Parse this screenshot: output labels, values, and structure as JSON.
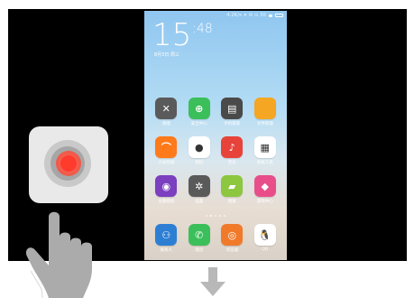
{
  "status_bar": {
    "text": "4.2K/s ✦ ✉ ⊙ 30"
  },
  "lock_clock": {
    "hours": "15",
    "minutes": "48",
    "date": "8月3日 周三"
  },
  "apps": [
    [
      {
        "label": "清理",
        "color": "#5a5a5a",
        "glyph": "✕",
        "icon": "cleaner-icon"
      },
      {
        "label": "安全中心",
        "color": "#3bbf5a",
        "glyph": "⊕",
        "icon": "security-shield-icon"
      },
      {
        "label": "手机管家",
        "color": "#4a4a4a",
        "glyph": "▤",
        "icon": "manager-icon"
      },
      {
        "label": "文件管理",
        "color": "#f5a623",
        "glyph": "",
        "icon": "folder-icon"
      }
    ],
    [
      {
        "label": "小米商城",
        "color": "#ff7a1a",
        "glyph": "⌒",
        "icon": "mi-store-icon"
      },
      {
        "label": "相机",
        "color": "#ffffff",
        "glyph": "●",
        "icon": "camera-icon"
      },
      {
        "label": "音乐",
        "color": "#e8433a",
        "glyph": "♪",
        "icon": "music-icon"
      },
      {
        "label": "系统工具",
        "color": "#ffffff",
        "glyph": "▦",
        "icon": "tools-folder-icon"
      }
    ],
    [
      {
        "label": "主题壁纸",
        "color": "#7b3fbf",
        "glyph": "◉",
        "icon": "themes-icon"
      },
      {
        "label": "设置",
        "color": "#5a5a5a",
        "glyph": "✲",
        "icon": "settings-gear-icon"
      },
      {
        "label": "相册",
        "color": "#8dc63f",
        "glyph": "▰",
        "icon": "gallery-icon"
      },
      {
        "label": "游戏中心",
        "color": "#e84f8a",
        "glyph": "◆",
        "icon": "game-center-icon"
      }
    ]
  ],
  "dock": [
    {
      "label": "联系人",
      "color": "#2d7fd4",
      "glyph": "⚇",
      "icon": "contacts-icon"
    },
    {
      "label": "电话",
      "color": "#3bbf5a",
      "glyph": "✆",
      "icon": "phone-icon"
    },
    {
      "label": "浏览器",
      "color": "#f07a2a",
      "glyph": "◎",
      "icon": "browser-icon"
    },
    {
      "label": "QQ",
      "color": "#ffffff",
      "glyph": "🐧",
      "icon": "qq-icon"
    }
  ]
}
